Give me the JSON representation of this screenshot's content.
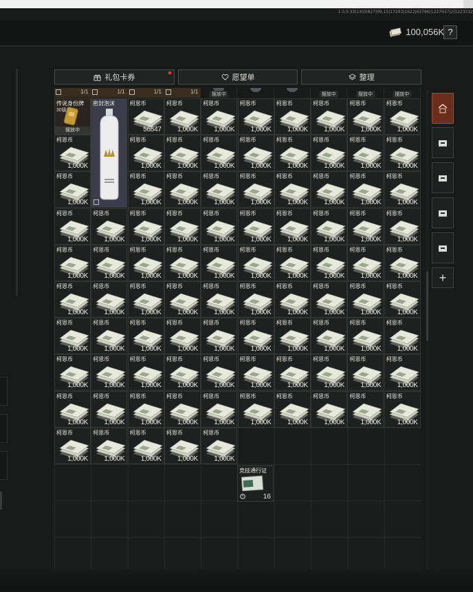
{
  "window": {
    "version": "1.0.0.33(14)|0827|09.15|17293|1622|63786|1227937|2|1223332"
  },
  "header": {
    "money_amount": "100,056K",
    "help_label": "?"
  },
  "toolbar": {
    "gift_label": "礼包卡券",
    "wishlist_label": "愿望单",
    "organize_label": "整理"
  },
  "top_strip": [
    {
      "value": "1/1",
      "status": ""
    },
    {
      "value": "1/1",
      "status": ""
    },
    {
      "value": "1/1",
      "status": ""
    },
    {
      "value": "1/1",
      "status": ""
    },
    {
      "value": "",
      "status": "摆放中"
    },
    {
      "value": "",
      "status": ""
    },
    {
      "value": "",
      "status": ""
    },
    {
      "value": "",
      "status": "摆放中"
    },
    {
      "value": "",
      "status": "摆放中"
    },
    {
      "value": "",
      "status": "摆放中"
    }
  ],
  "special_items": {
    "legend_label": "传说身份牌",
    "legend_sub": "30级",
    "legend_status": "摆放中",
    "sealed_label": "密封泡沫",
    "first_stack_count": "56547",
    "pass_label": "竞技通行证",
    "pass_count": "16"
  },
  "currency": {
    "name": "柯恩币",
    "stack": "1,000K",
    "row_counts": [
      9,
      10,
      10,
      10,
      10,
      10,
      10,
      10,
      10,
      5
    ]
  },
  "colors": {
    "accent": "#6b2e1e",
    "alert": "#e03a2e",
    "background": "#191a1a"
  }
}
